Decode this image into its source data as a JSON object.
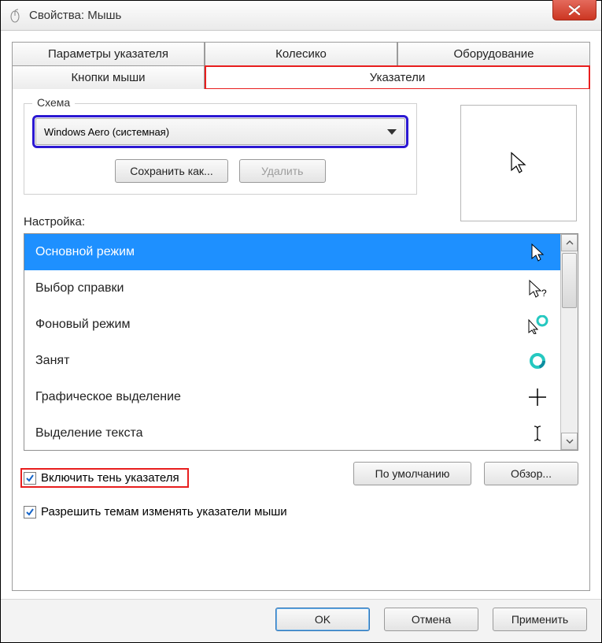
{
  "window": {
    "title": "Свойства: Мышь"
  },
  "tabs": {
    "row1": [
      {
        "label": "Параметры указателя"
      },
      {
        "label": "Колесико"
      },
      {
        "label": "Оборудование"
      }
    ],
    "row2": [
      {
        "label": "Кнопки мыши"
      },
      {
        "label": "Указатели",
        "active": true
      }
    ]
  },
  "scheme": {
    "legend": "Схема",
    "selected": "Windows Aero (системная)",
    "save_as": "Сохранить как...",
    "delete": "Удалить"
  },
  "customize_label": "Настройка:",
  "cursor_list": [
    {
      "label": "Основной режим",
      "icon": "arrow",
      "selected": true
    },
    {
      "label": "Выбор справки",
      "icon": "arrow-help"
    },
    {
      "label": "Фоновый режим",
      "icon": "arrow-busy"
    },
    {
      "label": "Занят",
      "icon": "busy"
    },
    {
      "label": "Графическое выделение",
      "icon": "cross"
    },
    {
      "label": "Выделение текста",
      "icon": "text"
    }
  ],
  "checkboxes": {
    "shadow": {
      "label": "Включить тень указателя",
      "checked": true
    },
    "themes": {
      "label": "Разрешить темам изменять указатели мыши",
      "checked": true
    }
  },
  "buttons": {
    "default": "По умолчанию",
    "browse": "Обзор...",
    "ok": "OK",
    "cancel": "Отмена",
    "apply": "Применить"
  }
}
